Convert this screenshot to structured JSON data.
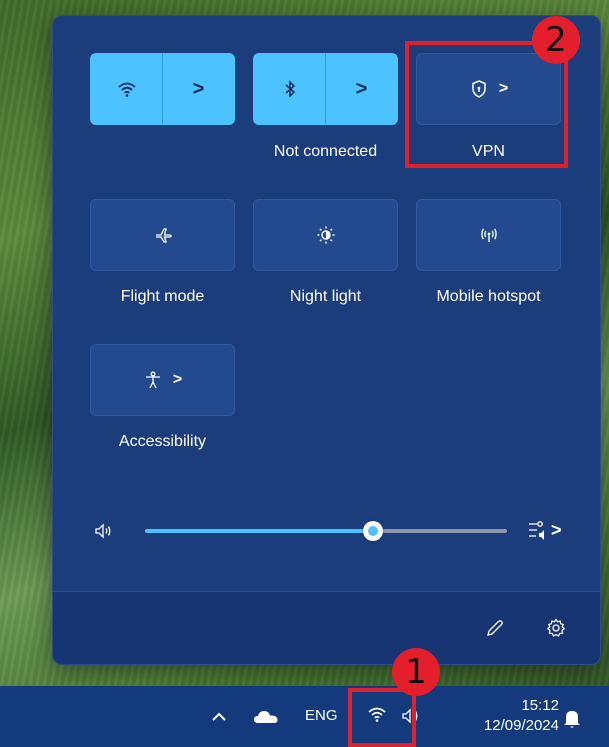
{
  "quick_settings": {
    "tiles": [
      {
        "id": "wifi",
        "label": "",
        "icon": "wifi-icon",
        "active": true
      },
      {
        "id": "bluetooth",
        "label": "Not connected",
        "icon": "bluetooth-icon",
        "active": true
      },
      {
        "id": "vpn",
        "label": "VPN",
        "icon": "shield-icon",
        "active": false
      },
      {
        "id": "flight",
        "label": "Flight mode",
        "icon": "airplane-icon",
        "active": false
      },
      {
        "id": "night",
        "label": "Night light",
        "icon": "brightness-icon",
        "active": false
      },
      {
        "id": "hotspot",
        "label": "Mobile hotspot",
        "icon": "hotspot-icon",
        "active": false
      },
      {
        "id": "accessibility",
        "label": "Accessibility",
        "icon": "accessibility-icon",
        "active": false
      }
    ],
    "chevron": ">",
    "volume": {
      "level_fraction": 0.63,
      "icon": "speaker-icon",
      "output_icon": "audio-output-icon"
    },
    "footer": {
      "edit_icon": "pencil-icon",
      "settings_icon": "gear-icon"
    }
  },
  "taskbar": {
    "language": "ENG",
    "time": "15:12",
    "date": "12/09/2024",
    "icons": [
      "chevron-up-icon",
      "cloud-icon",
      "wifi-icon",
      "speaker-icon",
      "bell-icon"
    ]
  },
  "annotations": {
    "marker_1": "1",
    "marker_2": "2"
  },
  "colors": {
    "accent": "#4cc2ff",
    "panel": "#1b3d7c",
    "marker": "#e41f2b"
  }
}
